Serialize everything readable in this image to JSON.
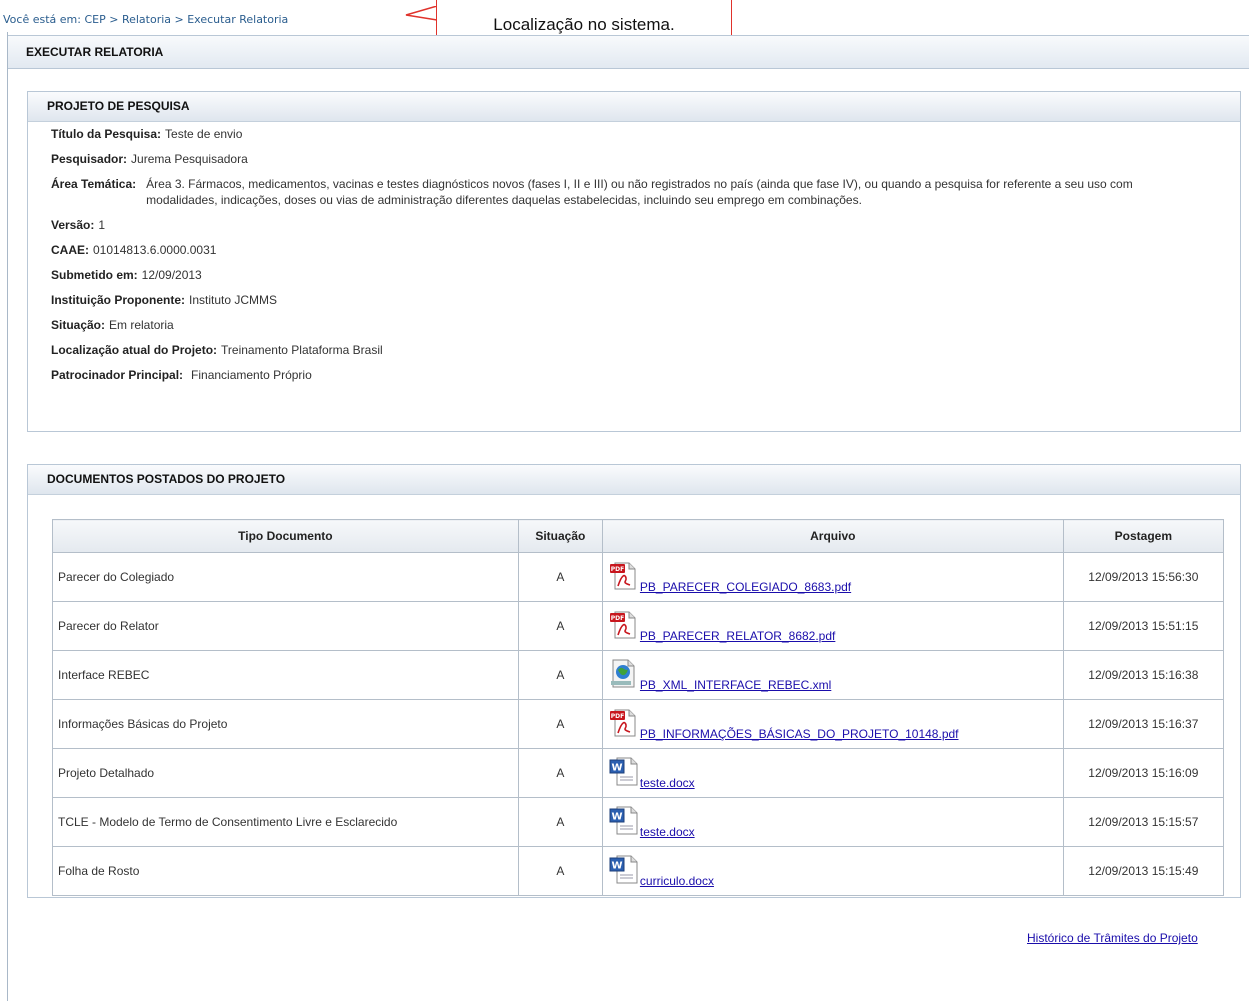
{
  "breadcrumb": {
    "prefix": "Você está em:",
    "items": [
      "CEP",
      "Relatoria",
      "Executar Relatoria"
    ],
    "separator": ">"
  },
  "callout": {
    "text": "Localização no sistema."
  },
  "page": {
    "title": "EXECUTAR RELATORIA"
  },
  "projeto": {
    "header": "PROJETO DE PESQUISA",
    "fields": [
      {
        "label": "Título da Pesquisa:",
        "value": "Teste de envio"
      },
      {
        "label": "Pesquisador:",
        "value": "Jurema Pesquisadora"
      },
      {
        "label": "Área Temática:",
        "value": "Área 3. Fármacos, medicamentos, vacinas e testes diagnósticos novos (fases I, II e III) ou não registrados no país (ainda que fase IV), ou quando a pesquisa for referente a seu uso com modalidades, indicações, doses ou vias de administração diferentes daquelas estabelecidas, incluindo seu emprego em combinações."
      },
      {
        "label": "Versão:",
        "value": "1"
      },
      {
        "label": "CAAE:",
        "value": "01014813.6.0000.0031"
      },
      {
        "label": "Submetido em:",
        "value": "12/09/2013"
      },
      {
        "label": "Instituição Proponente:",
        "value": "Instituto JCMMS"
      },
      {
        "label": "Situação:",
        "value": "Em relatoria"
      },
      {
        "label": "Localização atual do Projeto:",
        "value": "Treinamento Plataforma Brasil"
      },
      {
        "label": "Patrocinador Principal:",
        "value": "Financiamento Próprio"
      }
    ]
  },
  "documentos": {
    "header": "DOCUMENTOS POSTADOS DO PROJETO",
    "columns": [
      "Tipo Documento",
      "Situação",
      "Arquivo",
      "Postagem"
    ],
    "rows": [
      {
        "tipo": "Parecer do Colegiado",
        "situacao": "A",
        "arquivo": "PB_PARECER_COLEGIADO_8683.pdf",
        "icon": "pdf-icon",
        "postagem": "12/09/2013 15:56:30"
      },
      {
        "tipo": "Parecer do Relator",
        "situacao": "A",
        "arquivo": "PB_PARECER_RELATOR_8682.pdf",
        "icon": "pdf-icon",
        "postagem": "12/09/2013 15:51:15"
      },
      {
        "tipo": "Interface REBEC",
        "situacao": "A",
        "arquivo": "PB_XML_INTERFACE_REBEC.xml",
        "icon": "xml-icon",
        "postagem": "12/09/2013 15:16:38"
      },
      {
        "tipo": "Informações Básicas do Projeto",
        "situacao": "A",
        "arquivo": "PB_INFORMAÇÕES_BÁSICAS_DO_PROJETO_10148.pdf",
        "icon": "pdf-icon",
        "postagem": "12/09/2013 15:16:37"
      },
      {
        "tipo": "Projeto Detalhado",
        "situacao": "A",
        "arquivo": "teste.docx",
        "icon": "word-icon",
        "postagem": "12/09/2013 15:16:09"
      },
      {
        "tipo": "TCLE - Modelo de Termo de Consentimento Livre e Esclarecido",
        "situacao": "A",
        "arquivo": "teste.docx",
        "icon": "word-icon",
        "postagem": "12/09/2013 15:15:57"
      },
      {
        "tipo": "Folha de Rosto",
        "situacao": "A",
        "arquivo": "curriculo.docx",
        "icon": "word-icon",
        "postagem": "12/09/2013 15:15:49"
      }
    ]
  },
  "footer": {
    "historico_link": "Histórico de Trâmites do Projeto"
  },
  "colors": {
    "link": "#1a0dab",
    "breadcrumb": "#2a5d8e",
    "callout_border": "#e0322b",
    "panel_border": "#b9c7d6"
  }
}
